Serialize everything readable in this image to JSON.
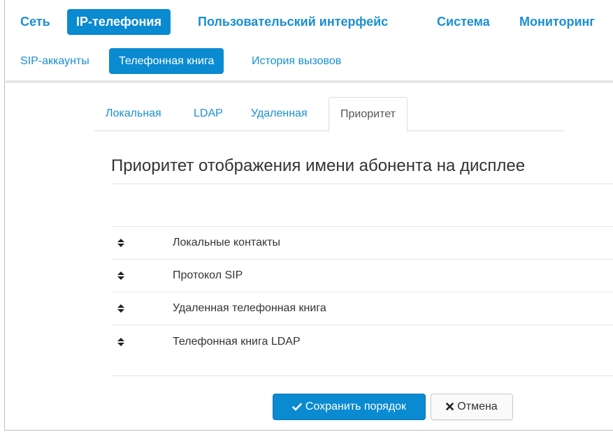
{
  "top_nav": {
    "items": [
      {
        "label": "Сеть",
        "active": false
      },
      {
        "label": "IP-телефония",
        "active": true
      },
      {
        "label": "Пользовательский интерфейс",
        "active": false
      },
      {
        "label": "Система",
        "active": false
      },
      {
        "label": "Мониторинг",
        "active": false
      }
    ]
  },
  "sub_nav": {
    "items": [
      {
        "label": "SIP-аккаунты",
        "active": false
      },
      {
        "label": "Телефонная книга",
        "active": true
      },
      {
        "label": "История вызовов",
        "active": false
      }
    ]
  },
  "tabs": [
    {
      "label": "Локальная",
      "active": false
    },
    {
      "label": "LDAP",
      "active": false
    },
    {
      "label": "Удаленная",
      "active": false
    },
    {
      "label": "Приоритет",
      "active": true
    }
  ],
  "page_title": "Приоритет отображения имени абонента на дисплее",
  "priority_list": [
    {
      "label": "Локальные контакты",
      "icon": "sort-icon"
    },
    {
      "label": "Протокол SIP",
      "icon": "sort-icon"
    },
    {
      "label": "Удаленная телефонная книга",
      "icon": "sort-icon"
    },
    {
      "label": "Телефонная книга LDAP",
      "icon": "sort-icon"
    }
  ],
  "buttons": {
    "save": {
      "label": "Сохранить порядок",
      "icon": "check-icon"
    },
    "cancel": {
      "label": "Отмена",
      "icon": "x-icon"
    }
  },
  "colors": {
    "accent": "#0a8ad1",
    "link": "#1a8fd2"
  }
}
